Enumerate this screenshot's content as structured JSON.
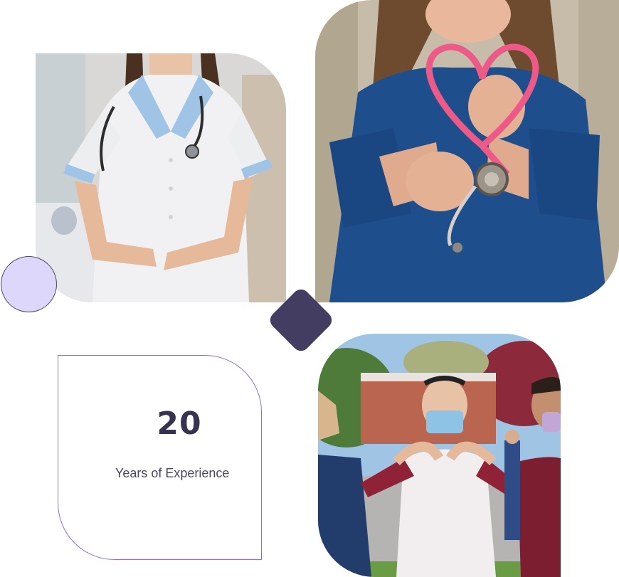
{
  "experience": {
    "number": "20",
    "label": "Years of Experience"
  },
  "colors": {
    "accent_dark": "#423d61",
    "accent_light": "#ddd7fb",
    "card_border": "#8d6ee6"
  }
}
